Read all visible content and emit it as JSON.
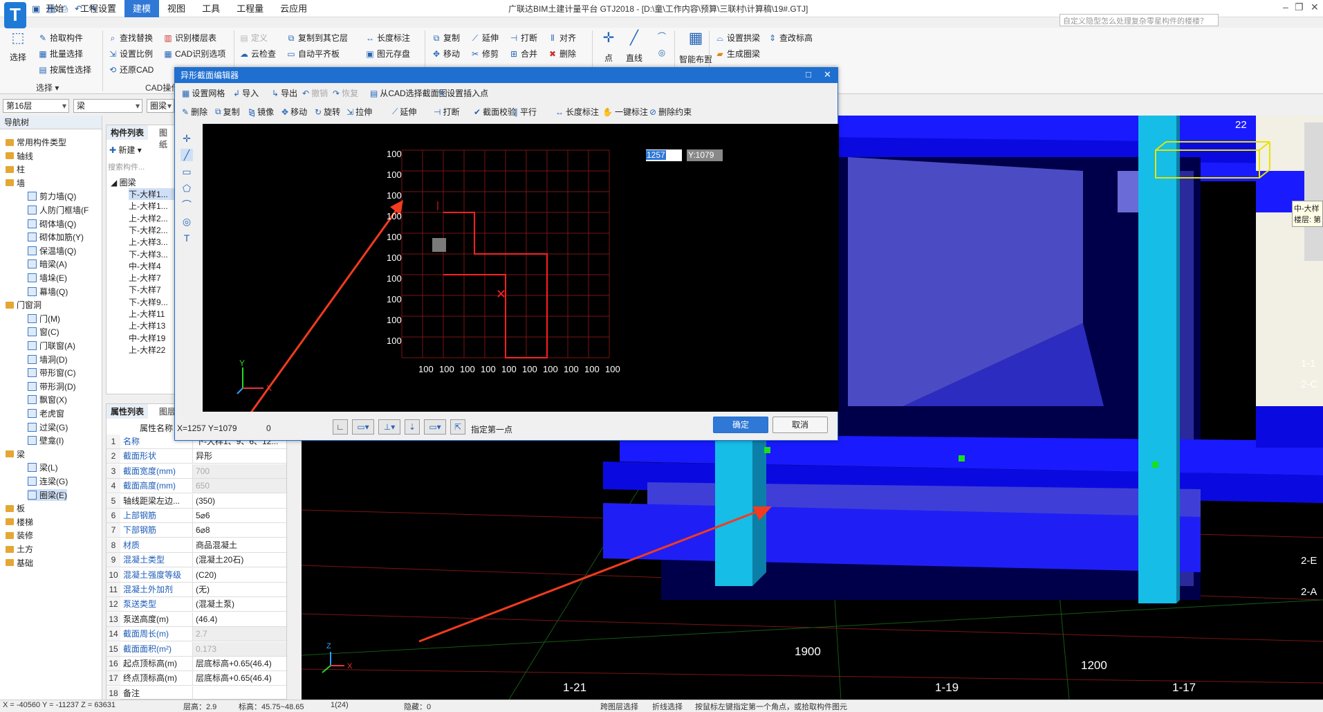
{
  "app": {
    "title": "广联达BIM土建计量平台 GTJ2018 - [D:\\童\\工作内容\\预算\\三联村\\计算稿\\19#.GTJ]",
    "search_placeholder": "自定义隐型怎么处理复杂零星构件的楼楼？"
  },
  "menu": [
    "开始",
    "工程设置",
    "建模",
    "视图",
    "工具",
    "工程量",
    "云应用"
  ],
  "ribbon": {
    "select_big": "选择",
    "select_items": [
      "拾取构件",
      "批量选择",
      "按属性选择"
    ],
    "select_group": "选择 ▾",
    "cad_items": [
      "查找替换",
      "设置比例",
      "还原CAD",
      "识别楼层表",
      "CAD识别选项"
    ],
    "cad_group": "CAD操作 ▾",
    "general_items": [
      "定义",
      "云检查",
      "复制到其它层",
      "自动平齐板",
      "长度标注",
      "图元存盘"
    ],
    "edit_items": [
      "复制",
      "移动",
      "延伸",
      "修剪",
      "打断",
      "合并",
      "对齐",
      "删除"
    ],
    "draw_items": [
      "点",
      "直线"
    ],
    "smart_label": "智能布置",
    "beam_items": [
      "设置拱梁",
      "生成圈梁",
      "查改标高"
    ]
  },
  "toolbar2": {
    "floor": "第16层",
    "type": "梁",
    "subtype": "圈梁"
  },
  "nav": {
    "title": "导航树",
    "items": [
      {
        "label": "常用构件类型",
        "level": 0
      },
      {
        "label": "轴线",
        "level": 0
      },
      {
        "label": "柱",
        "level": 0
      },
      {
        "label": "墙",
        "level": 0
      },
      {
        "label": "剪力墙(Q)",
        "level": 1
      },
      {
        "label": "人防门框墙(F",
        "level": 1
      },
      {
        "label": "砌体墙(Q)",
        "level": 1
      },
      {
        "label": "砌体加筋(Y)",
        "level": 1
      },
      {
        "label": "保温墙(Q)",
        "level": 1
      },
      {
        "label": "暗梁(A)",
        "level": 1
      },
      {
        "label": "墙垛(E)",
        "level": 1
      },
      {
        "label": "幕墙(Q)",
        "level": 1
      },
      {
        "label": "门窗洞",
        "level": 0
      },
      {
        "label": "门(M)",
        "level": 1
      },
      {
        "label": "窗(C)",
        "level": 1
      },
      {
        "label": "门联窗(A)",
        "level": 1
      },
      {
        "label": "墙洞(D)",
        "level": 1
      },
      {
        "label": "带形窗(C)",
        "level": 1
      },
      {
        "label": "带形洞(D)",
        "level": 1
      },
      {
        "label": "飘窗(X)",
        "level": 1
      },
      {
        "label": "老虎窗",
        "level": 1
      },
      {
        "label": "过梁(G)",
        "level": 1
      },
      {
        "label": "壁龛(I)",
        "level": 1
      },
      {
        "label": "梁",
        "level": 0
      },
      {
        "label": "梁(L)",
        "level": 1
      },
      {
        "label": "连梁(G)",
        "level": 1
      },
      {
        "label": "圈梁(E)",
        "level": 1
      },
      {
        "label": "板",
        "level": 0
      },
      {
        "label": "楼梯",
        "level": 0
      },
      {
        "label": "装修",
        "level": 0
      },
      {
        "label": "土方",
        "level": 0
      },
      {
        "label": "基础",
        "level": 0
      }
    ]
  },
  "complist": {
    "tab1": "构件列表",
    "tab2": "图纸",
    "new": "新建",
    "search": "搜索构件...",
    "root": "圈梁",
    "items": [
      "下-大样1...",
      "上-大样1...",
      "上-大样2...",
      "下-大样2...",
      "上-大样3...",
      "下-大样3...",
      "中-大样4",
      "上-大样7",
      "下-大样7",
      "下-大样9...",
      "上-大样11",
      "上-大样13",
      "中-大样19",
      "上-大样22"
    ]
  },
  "props": {
    "tab1": "属性列表",
    "tab2": "图层",
    "header": "属性名称",
    "rows": [
      {
        "n": "1",
        "k": "名称",
        "v": "下-大样1、9、6、12...",
        "blue": true,
        "gray": false
      },
      {
        "n": "2",
        "k": "截面形状",
        "v": "异形",
        "blue": true,
        "gray": false
      },
      {
        "n": "3",
        "k": "截面宽度(mm)",
        "v": "700",
        "blue": true,
        "gray": true
      },
      {
        "n": "4",
        "k": "截面高度(mm)",
        "v": "650",
        "blue": true,
        "gray": true
      },
      {
        "n": "5",
        "k": "轴线距梁左边...",
        "v": "(350)",
        "blue": false,
        "gray": false
      },
      {
        "n": "6",
        "k": "上部钢筋",
        "v": "5⌀6",
        "blue": true,
        "gray": false
      },
      {
        "n": "7",
        "k": "下部钢筋",
        "v": "6⌀8",
        "blue": true,
        "gray": false
      },
      {
        "n": "8",
        "k": "材质",
        "v": "商品混凝土",
        "blue": true,
        "gray": false
      },
      {
        "n": "9",
        "k": "混凝土类型",
        "v": "(混凝土20石)",
        "blue": true,
        "gray": false
      },
      {
        "n": "10",
        "k": "混凝土强度等级",
        "v": "(C20)",
        "blue": true,
        "gray": false
      },
      {
        "n": "11",
        "k": "混凝土外加剂",
        "v": "(无)",
        "blue": true,
        "gray": false
      },
      {
        "n": "12",
        "k": "泵送类型",
        "v": "(混凝土泵)",
        "blue": true,
        "gray": false
      },
      {
        "n": "13",
        "k": "泵送高度(m)",
        "v": "(46.4)",
        "blue": false,
        "gray": false
      },
      {
        "n": "14",
        "k": "截面周长(m)",
        "v": "2.7",
        "blue": true,
        "gray": true
      },
      {
        "n": "15",
        "k": "截面面积(m²)",
        "v": "0.173",
        "blue": true,
        "gray": true
      },
      {
        "n": "16",
        "k": "起点顶标高(m)",
        "v": "层底标高+0.65(46.4)",
        "blue": false,
        "gray": false
      },
      {
        "n": "17",
        "k": "终点顶标高(m)",
        "v": "层底标高+0.65(46.4)",
        "blue": false,
        "gray": false
      },
      {
        "n": "18",
        "k": "备注",
        "v": "",
        "blue": false,
        "gray": false
      }
    ]
  },
  "dialog": {
    "title": "异形截面编辑器",
    "tb1": [
      "设置网格",
      "导入",
      "导出",
      "撤销",
      "恢复",
      "从CAD选择截面图",
      "设置插入点"
    ],
    "tb2": [
      "删除",
      "复制",
      "镜像",
      "移动",
      "旋转",
      "拉伸",
      "延伸",
      "打断",
      "截面校验",
      "平行",
      "长度标注",
      "一键标注",
      "删除约束"
    ],
    "input_x": "1257",
    "input_y": "Y:1079",
    "grid_y_labels": [
      "100",
      "100",
      "100",
      "100",
      "100",
      "100",
      "100",
      "100",
      "100",
      "100"
    ],
    "grid_x_labels": [
      "100",
      "100",
      "100",
      "100",
      "100",
      "100",
      "100",
      "100",
      "100",
      "100"
    ],
    "coords": "X=1257 Y=1079",
    "zero": "0",
    "hint": "指定第一点",
    "ok": "确定",
    "cancel": "取消"
  },
  "viewport": {
    "labels": [
      "22",
      "1-1",
      "2-C",
      "2-E",
      "2-A",
      "1900",
      "1200",
      "1-21",
      "1-19",
      "1-17"
    ],
    "tooltip": "中-大样\n楼层: 第"
  },
  "status": {
    "coords": "X = -40560 Y = -11237 Z = 63631",
    "floor": "层高：2.9",
    "elev": "标高：45.75~48.65",
    "count": "1(24)",
    "hidden": "隐藏：0",
    "btn1": "跨图层选择",
    "btn2": "折线选择",
    "hint": "按鼠标左键指定第一个角点，或拾取构件图元"
  }
}
